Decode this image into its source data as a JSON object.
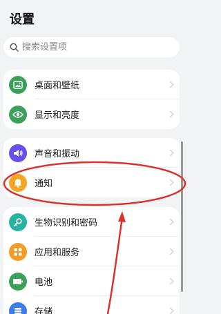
{
  "header": {
    "title": "设置"
  },
  "search": {
    "placeholder": "搜索设置项"
  },
  "groups": [
    {
      "items": [
        {
          "label": "桌面和壁纸",
          "icon": "image-icon",
          "color": "#3aa15a"
        },
        {
          "label": "显示和亮度",
          "icon": "eye-icon",
          "color": "#3aa15a"
        }
      ]
    },
    {
      "items": [
        {
          "label": "声音和振动",
          "icon": "speaker-icon",
          "color": "#6a4ff0"
        },
        {
          "label": "通知",
          "icon": "bell-icon",
          "color": "#f5a623"
        }
      ]
    },
    {
      "items": [
        {
          "label": "生物识别和密码",
          "icon": "key-icon",
          "color": "#26b5a3"
        },
        {
          "label": "应用和服务",
          "icon": "apps-icon",
          "color": "#f59a23"
        },
        {
          "label": "电池",
          "icon": "battery-icon",
          "color": "#3aa15a"
        },
        {
          "label": "存储",
          "icon": "storage-icon",
          "color": "#3a7cf0"
        }
      ]
    }
  ],
  "annotation": {
    "color": "#d9322e"
  }
}
